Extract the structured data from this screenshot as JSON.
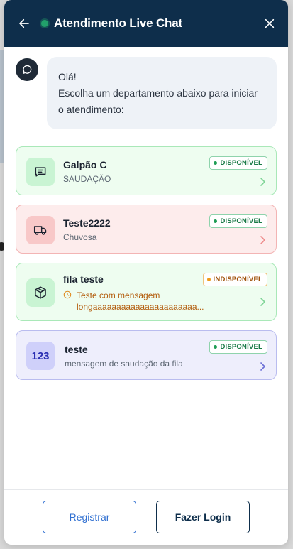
{
  "header": {
    "title": "Atendimento Live Chat",
    "status_color": "#22a06b",
    "back_icon": "arrow-left-icon",
    "close_icon": "close-icon"
  },
  "message": {
    "line1": "Olá!",
    "line2": "Escolha um departamento abaixo para iniciar o atendimento:"
  },
  "departments": [
    {
      "name": "Galpão C",
      "subtitle": "SAUDAÇÃO",
      "status": "DISPONÍVEL",
      "icon": "message-icon",
      "theme": "green"
    },
    {
      "name": "Teste2222",
      "subtitle": "Chuvosa",
      "status": "DISPONÍVEL",
      "icon": "truck-icon",
      "theme": "red"
    },
    {
      "name": "fila teste",
      "subtitle": "Teste com mensagem longaaaaaaaaaaaaaaaaaaaaaa...",
      "status": "INDISPONÍVEL",
      "icon": "box-icon",
      "theme": "green"
    },
    {
      "name": "teste",
      "subtitle": "mensagem de saudação da fila",
      "status": "DISPONÍVEL",
      "icon_text": "123",
      "theme": "violet"
    }
  ],
  "footer": {
    "register_label": "Registrar",
    "login_label": "Fazer Login"
  }
}
